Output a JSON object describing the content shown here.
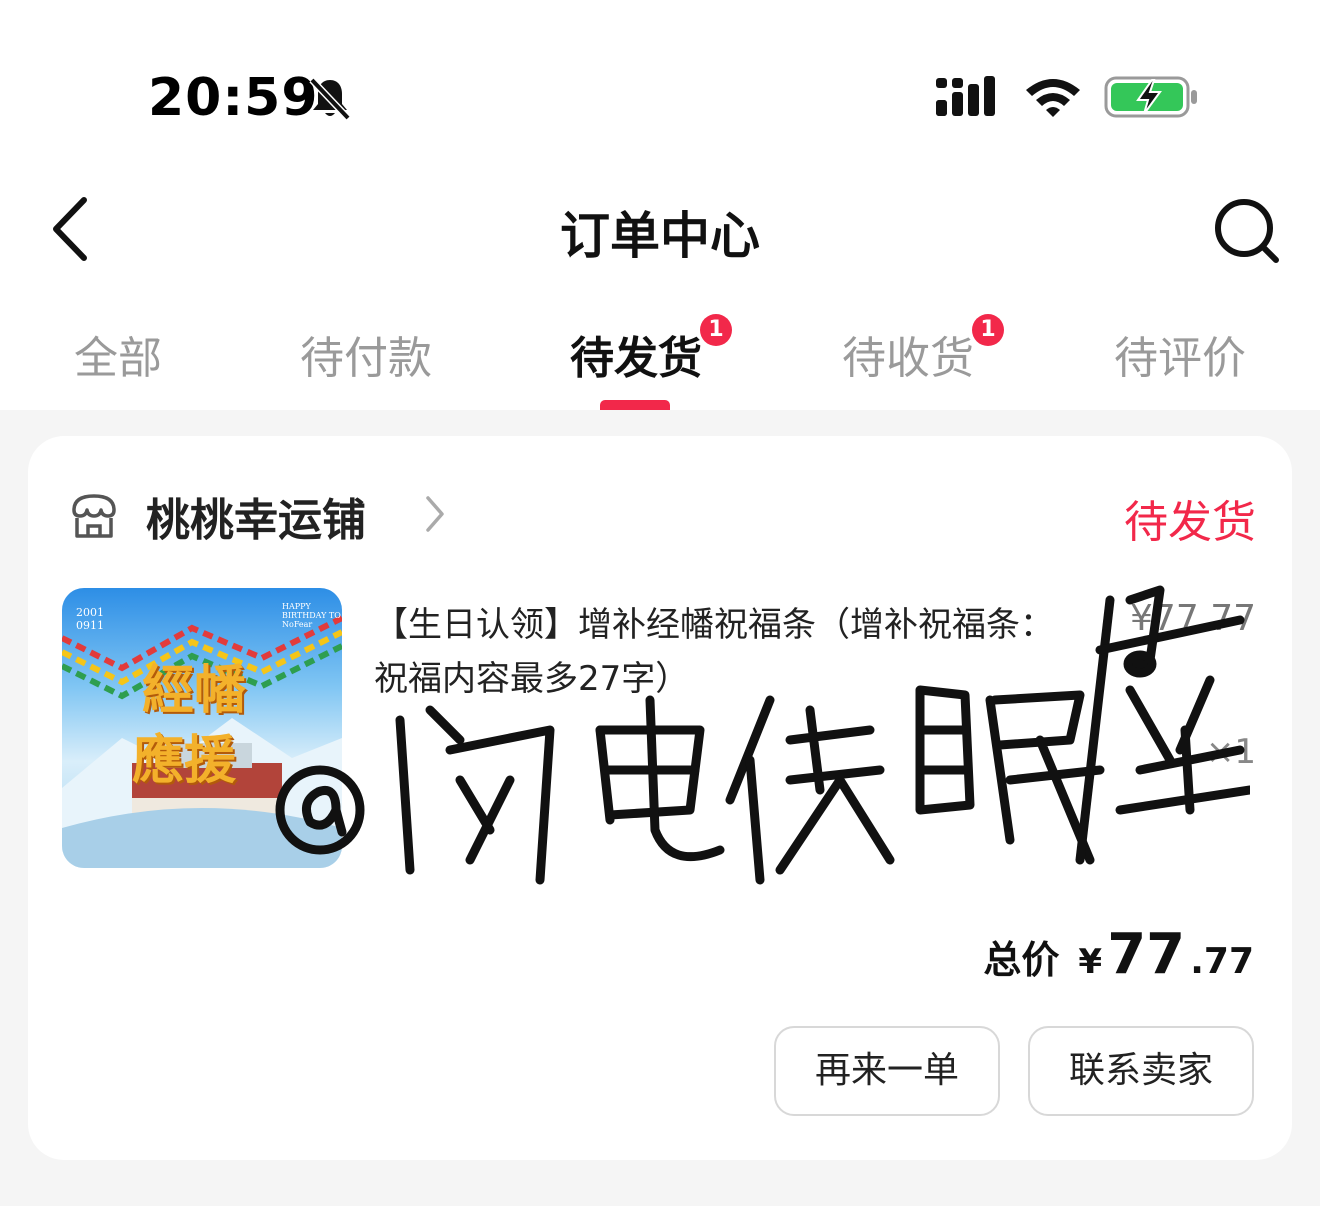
{
  "status_bar": {
    "time": "20:59",
    "icons": [
      "bell-off-icon",
      "signal-icon",
      "wifi-icon",
      "battery-charging-icon"
    ],
    "battery_color": "#34c759"
  },
  "nav": {
    "title": "订单中心",
    "icons": [
      "back-arrow-icon",
      "search-icon"
    ]
  },
  "tabs": [
    {
      "label": "全部",
      "badge": ""
    },
    {
      "label": "待付款",
      "badge": ""
    },
    {
      "label": "待发货",
      "badge": "1",
      "active": true
    },
    {
      "label": "待收货",
      "badge": "1"
    },
    {
      "label": "待评价",
      "badge": ""
    }
  ],
  "order": {
    "shop_name": "桃桃幸运铺",
    "status": "待发货",
    "product": {
      "title": "【生日认领】增补经幡祝福条（增补祝福条：祝福内容最多27字）",
      "price": "¥77.77",
      "quantity": "×1",
      "image_text_main": [
        "經幡",
        "應援"
      ],
      "image_text_date": "2001 0911",
      "image_text_birthday": "HAPPY BIRTHDAY TO NoFear"
    },
    "total": {
      "label": "总价",
      "currency": "¥",
      "integer": "77",
      "decimal": ".77"
    },
    "buttons": {
      "reorder": "再来一单",
      "contact_seller": "联系卖家"
    }
  },
  "watermark_text": "@闪电侠眠座",
  "colors": {
    "accent": "#f2284a",
    "background": "#f5f5f5",
    "card": "#ffffff"
  }
}
